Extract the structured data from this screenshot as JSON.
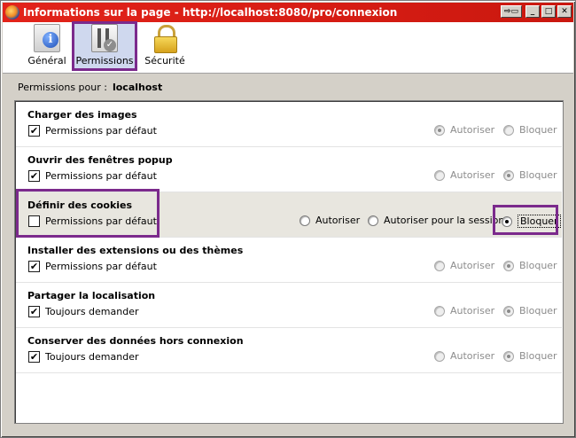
{
  "window": {
    "title": "Informations sur la page - http://localhost:8080/pro/connexion",
    "buttons": [
      "restore-down",
      "minimize",
      "maximize",
      "close"
    ]
  },
  "toolbar": {
    "tabs": [
      {
        "label": "Général",
        "icon": "info-icon",
        "active": false
      },
      {
        "label": "Permissions",
        "icon": "permissions-icon",
        "active": true
      },
      {
        "label": "Sécurité",
        "icon": "lock-icon",
        "active": false
      }
    ]
  },
  "permissions_for": {
    "label": "Permissions pour :",
    "host": "localhost"
  },
  "rows": [
    {
      "title": "Charger des images",
      "checkbox": {
        "label": "Permissions par défaut",
        "checked": true
      },
      "radios": [
        {
          "label": "Autoriser",
          "selected": true,
          "enabled": false
        },
        {
          "label": "Bloquer",
          "selected": false,
          "enabled": false
        }
      ]
    },
    {
      "title": "Ouvrir des fenêtres popup",
      "checkbox": {
        "label": "Permissions par défaut",
        "checked": true
      },
      "radios": [
        {
          "label": "Autoriser",
          "selected": false,
          "enabled": false
        },
        {
          "label": "Bloquer",
          "selected": true,
          "enabled": false
        }
      ]
    },
    {
      "title": "Définir des cookies",
      "checkbox": {
        "label": "Permissions par défaut",
        "checked": false
      },
      "radios": [
        {
          "label": "Autoriser",
          "selected": false,
          "enabled": true
        },
        {
          "label": "Autoriser pour la session",
          "selected": false,
          "enabled": true
        },
        {
          "label": "Bloquer",
          "selected": true,
          "enabled": true
        }
      ]
    },
    {
      "title": "Installer des extensions ou des thèmes",
      "checkbox": {
        "label": "Permissions par défaut",
        "checked": true
      },
      "radios": [
        {
          "label": "Autoriser",
          "selected": false,
          "enabled": false
        },
        {
          "label": "Bloquer",
          "selected": true,
          "enabled": false
        }
      ]
    },
    {
      "title": "Partager la localisation",
      "checkbox": {
        "label": "Toujours demander",
        "checked": true
      },
      "radios": [
        {
          "label": "Autoriser",
          "selected": false,
          "enabled": false
        },
        {
          "label": "Bloquer",
          "selected": true,
          "enabled": false
        }
      ]
    },
    {
      "title": "Conserver des données hors connexion",
      "checkbox": {
        "label": "Toujours demander",
        "checked": true
      },
      "radios": [
        {
          "label": "Autoriser",
          "selected": false,
          "enabled": false
        },
        {
          "label": "Bloquer",
          "selected": true,
          "enabled": false
        }
      ]
    }
  ],
  "colors": {
    "titlebar": "#d61c13",
    "highlight": "#7b2a8c",
    "dialog": "#d4d0c8"
  }
}
